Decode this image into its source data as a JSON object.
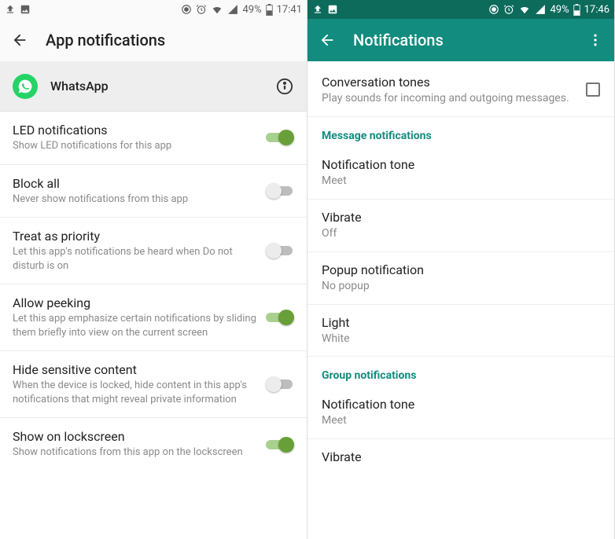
{
  "left": {
    "status": {
      "battery": "49%",
      "time": "17:41"
    },
    "toolbar": {
      "title": "App notifications"
    },
    "app": {
      "name": "WhatsApp"
    },
    "settings": [
      {
        "title": "LED notifications",
        "sub": "Show LED notifications for this app",
        "on": true
      },
      {
        "title": "Block all",
        "sub": "Never show notifications from this app",
        "on": false
      },
      {
        "title": "Treat as priority",
        "sub": "Let this app's notifications be heard when Do not disturb is on",
        "on": false
      },
      {
        "title": "Allow peeking",
        "sub": "Let this app emphasize certain notifications by sliding them briefly into view on the current screen",
        "on": true
      },
      {
        "title": "Hide sensitive content",
        "sub": "When the device is locked, hide content in this app's notifications that might reveal private information",
        "on": false
      },
      {
        "title": "Show on lockscreen",
        "sub": "Show notifications from this app on the lockscreen",
        "on": true
      }
    ]
  },
  "right": {
    "status": {
      "battery": "49%",
      "time": "17:46"
    },
    "toolbar": {
      "title": "Notifications"
    },
    "conversation_tones": {
      "title": "Conversation tones",
      "sub": "Play sounds for incoming and outgoing messages.",
      "checked": false
    },
    "section1": "Message notifications",
    "msg": [
      {
        "title": "Notification tone",
        "sub": "Meet"
      },
      {
        "title": "Vibrate",
        "sub": "Off"
      },
      {
        "title": "Popup notification",
        "sub": "No popup"
      },
      {
        "title": "Light",
        "sub": "White"
      }
    ],
    "section2": "Group notifications",
    "grp": [
      {
        "title": "Notification tone",
        "sub": "Meet"
      },
      {
        "title": "Vibrate",
        "sub": ""
      }
    ]
  }
}
